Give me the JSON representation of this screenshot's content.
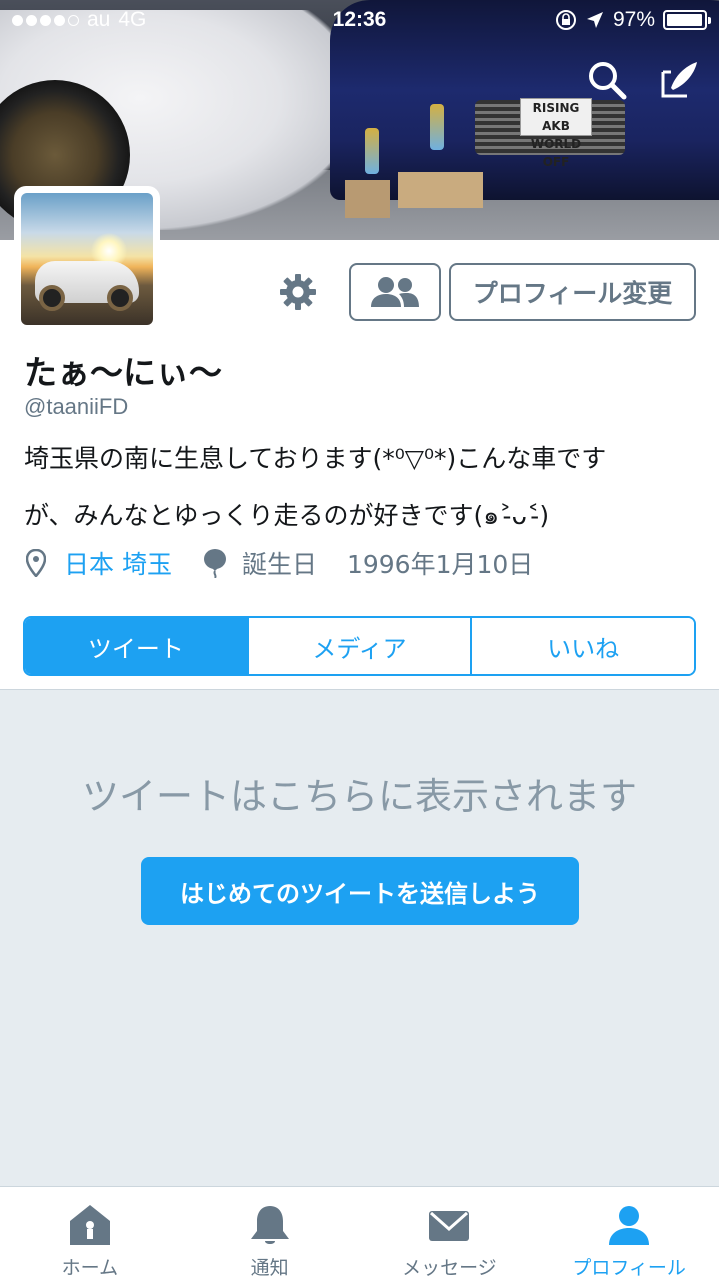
{
  "status_bar": {
    "carrier": "au",
    "network": "4G",
    "time": "12:36",
    "battery": "97%",
    "battery_level": 0.97
  },
  "banner": {
    "plate_text": "RISING\nAKB WORLD OFF"
  },
  "profile": {
    "display_name": "たぁ〜にぃ〜",
    "handle": "@taaniiFD",
    "bio_line1": "埼玉県の南に生息しております(*⁰▽⁰*)こんな車です",
    "bio_line2": "が、みんなとゆっくり走るのが好きです(๑˃̵ᴗ˂̵)",
    "location": "日本 埼玉",
    "birthday_label": "誕生日",
    "birthday": "1996年1月10日"
  },
  "actions": {
    "edit_profile": "プロフィール変更"
  },
  "tabs": [
    {
      "label": "ツイート",
      "active": true
    },
    {
      "label": "メディア",
      "active": false
    },
    {
      "label": "いいね",
      "active": false
    }
  ],
  "empty_state": {
    "message": "ツイートはこちらに表示されます",
    "cta": "はじめてのツイートを送信しよう"
  },
  "tab_bar": [
    {
      "label": "ホーム",
      "icon": "home-icon",
      "active": false
    },
    {
      "label": "通知",
      "icon": "bell-icon",
      "active": false
    },
    {
      "label": "メッセージ",
      "icon": "envelope-icon",
      "active": false
    },
    {
      "label": "プロフィール",
      "icon": "person-icon",
      "active": true
    }
  ],
  "colors": {
    "accent": "#1da1f2",
    "secondary_text": "#657786",
    "timeline_bg": "#e6ecf0"
  }
}
